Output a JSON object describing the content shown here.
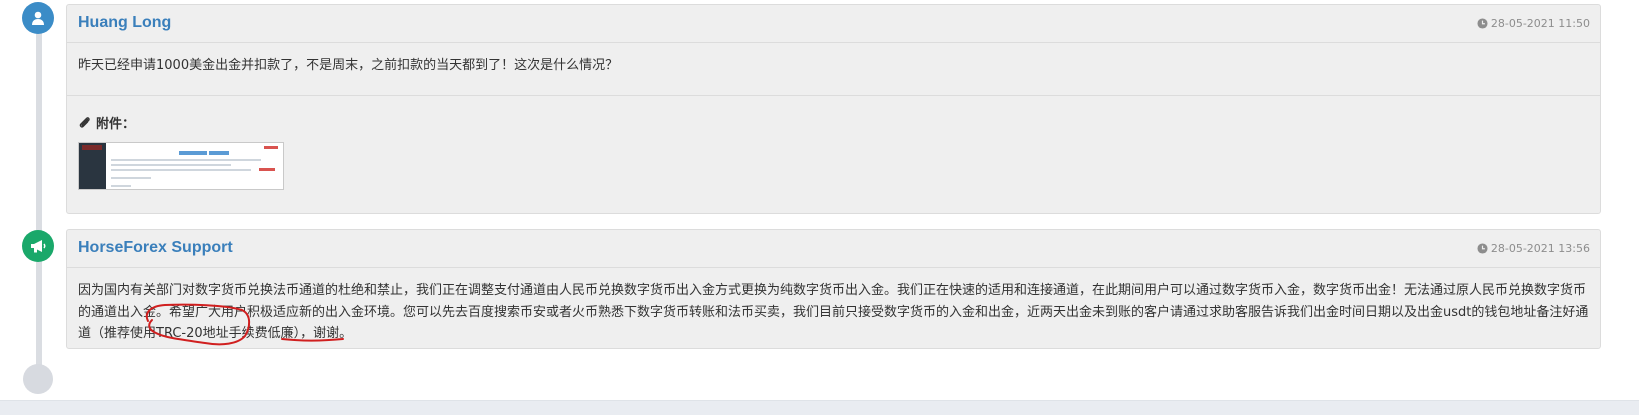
{
  "posts": [
    {
      "author": "Huang Long",
      "timestamp": "28-05-2021 11:50",
      "message": "昨天已经申请1000美金出金并扣款了，不是周末，之前扣款的当天都到了！这次是什么情况？",
      "attachments_label": "附件：",
      "avatar_icon": "user-icon",
      "avatar_color": "#3b8cc7"
    },
    {
      "author": "HorseForex Support",
      "timestamp": "28-05-2021 13:56",
      "message": "因为国内有关部门对数字货币兑换法币通道的杜绝和禁止，我们正在调整支付通道由人民币兑换数字货币出入金方式更换为纯数字货币出入金。我们正在快速的适用和连接通道，在此期间用户可以通过数字货币入金，数字货币出金！无法通过原人民币兑换数字货币的通道出入金。希望广大用户积极适应新的出入金环境。您可以先去百度搜索币安或者火币熟悉下数字货币转账和法币买卖，我们目前只接受数字货币的入金和出金，近两天出金未到账的客户请通过求助客服告诉我们出金时间日期以及出金usdt的钱包地址备注好通道（推荐使用TRC-20地址手续费低廉），谢谢。",
      "avatar_icon": "megaphone-icon",
      "avatar_color": "#1aa86a"
    }
  ],
  "colors": {
    "author": "#3a7fbb",
    "annotation": "#d01f1f",
    "timeline": "#dadde2"
  }
}
